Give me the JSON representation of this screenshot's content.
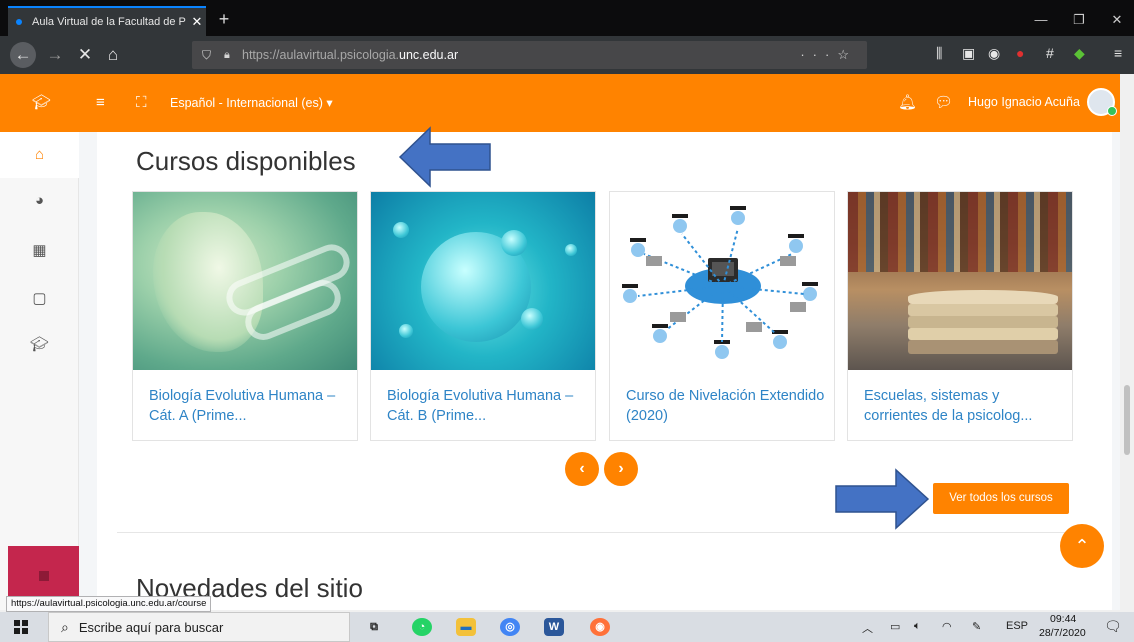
{
  "browser": {
    "tab_title": "Aula Virtual de la Facultad de P",
    "tab_close": "✕",
    "new_tab": "+",
    "url_prefix": "https://aulavirtual.psicologia.",
    "url_domain": "unc.edu.ar",
    "window_controls": {
      "minimize": "—",
      "restore": "❐",
      "close": "✕"
    },
    "toolbar_icons": [
      "library-icon",
      "sidebar-icon",
      "account-icon",
      "extension-icon",
      "grid-icon",
      "extension-badge-icon",
      "menu-icon"
    ]
  },
  "site_header": {
    "language": "Español - Internacional (es) ▾",
    "user_name": "Hugo Ignacio Acuña"
  },
  "drawer": {
    "items": [
      "home-icon",
      "dashboard-icon",
      "calendar-icon",
      "file-icon",
      "graduation-cap-icon"
    ]
  },
  "main": {
    "section_title": "Cursos disponibles",
    "courses": [
      {
        "name": "Biología Evolutiva Humana – Cát. A (Prime..."
      },
      {
        "name": "Biología Evolutiva Humana – Cát. B (Prime..."
      },
      {
        "name": "Curso de Nivelación Extendido (2020)"
      },
      {
        "name": "Escuelas, sistemas y corrientes de la psicolog..."
      }
    ],
    "carousel_prev": "‹",
    "carousel_next": "›",
    "view_all": "Ver todos los cursos",
    "news_title": "Novedades del sitio"
  },
  "status_url": "https://aulavirtual.psicologia.unc.edu.ar/course",
  "taskbar": {
    "search_placeholder": "Escribe aquí para buscar",
    "language": "ESP",
    "time": "09:44",
    "date": "28/7/2020"
  },
  "colors": {
    "accent": "#ff8300",
    "link": "#2e84c6",
    "annotation_arrow": "#4472c4"
  }
}
